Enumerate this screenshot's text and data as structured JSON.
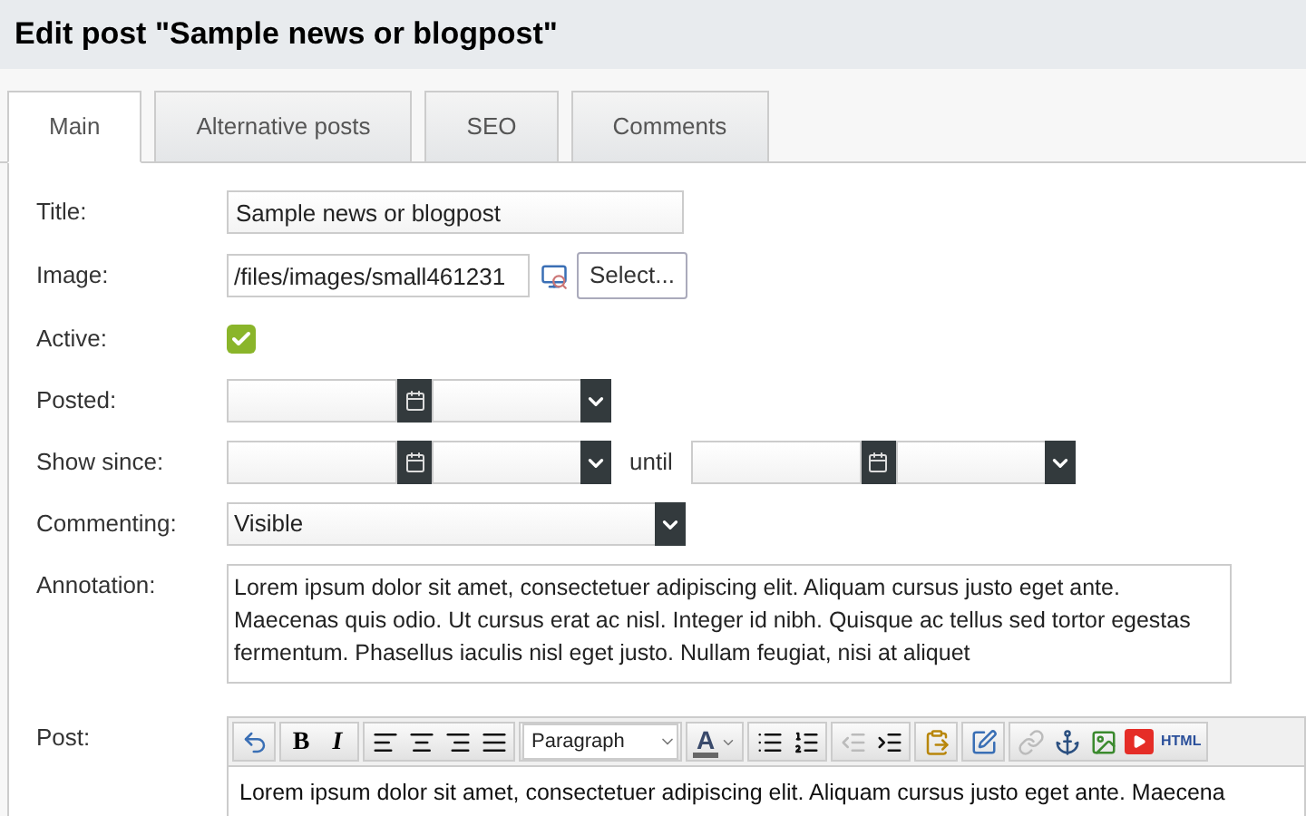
{
  "page_title": "Edit post \"Sample news or blogpost\"",
  "tabs": [
    {
      "label": "Main",
      "selected": true
    },
    {
      "label": "Alternative posts",
      "selected": false
    },
    {
      "label": "SEO",
      "selected": false
    },
    {
      "label": "Comments",
      "selected": false
    }
  ],
  "form": {
    "title": {
      "label": "Title:",
      "value": "Sample news or blogpost"
    },
    "image": {
      "label": "Image:",
      "value": "/files/images/small461231",
      "button": "Select..."
    },
    "active": {
      "label": "Active:",
      "checked": true
    },
    "posted": {
      "label": "Posted:"
    },
    "show_since": {
      "label": "Show since:",
      "until_label": "until"
    },
    "commenting": {
      "label": "Commenting:",
      "value": "Visible"
    },
    "annotation": {
      "label": "Annotation:",
      "value": "Lorem ipsum dolor sit amet, consectetuer adipiscing elit. Aliquam cursus justo eget ante. Maecenas quis odio. Ut cursus erat ac nisl. Integer id nibh. Quisque ac tellus sed tortor egestas fermentum. Phasellus iaculis nisl eget justo. Nullam feugiat, nisi at aliquet"
    },
    "post": {
      "label": "Post:",
      "toolbar": [
        [
          {
            "kind": "undo"
          }
        ],
        [
          {
            "kind": "bold",
            "label": "B"
          },
          {
            "kind": "italic",
            "label": "I"
          }
        ],
        [
          {
            "kind": "align-left"
          },
          {
            "kind": "align-center"
          },
          {
            "kind": "align-right"
          },
          {
            "kind": "align-justify"
          }
        ],
        [
          {
            "kind": "select",
            "label": "Paragraph"
          }
        ],
        [
          {
            "kind": "font-color",
            "label": "A"
          }
        ],
        [
          {
            "kind": "bullet-list"
          },
          {
            "kind": "numbered-list"
          }
        ],
        [
          {
            "kind": "outdent",
            "disabled": true
          },
          {
            "kind": "indent",
            "disabled": false
          }
        ],
        [
          {
            "kind": "paste-word"
          }
        ],
        [
          {
            "kind": "edit"
          }
        ],
        [
          {
            "kind": "link",
            "disabled": true
          },
          {
            "kind": "anchor",
            "disabled": false
          },
          {
            "kind": "image"
          },
          {
            "kind": "video"
          },
          {
            "kind": "html",
            "label": "HTML"
          }
        ]
      ],
      "content": "Lorem ipsum dolor sit amet, consectetuer adipiscing elit. Aliquam cursus justo eget ante. Maecena"
    }
  }
}
